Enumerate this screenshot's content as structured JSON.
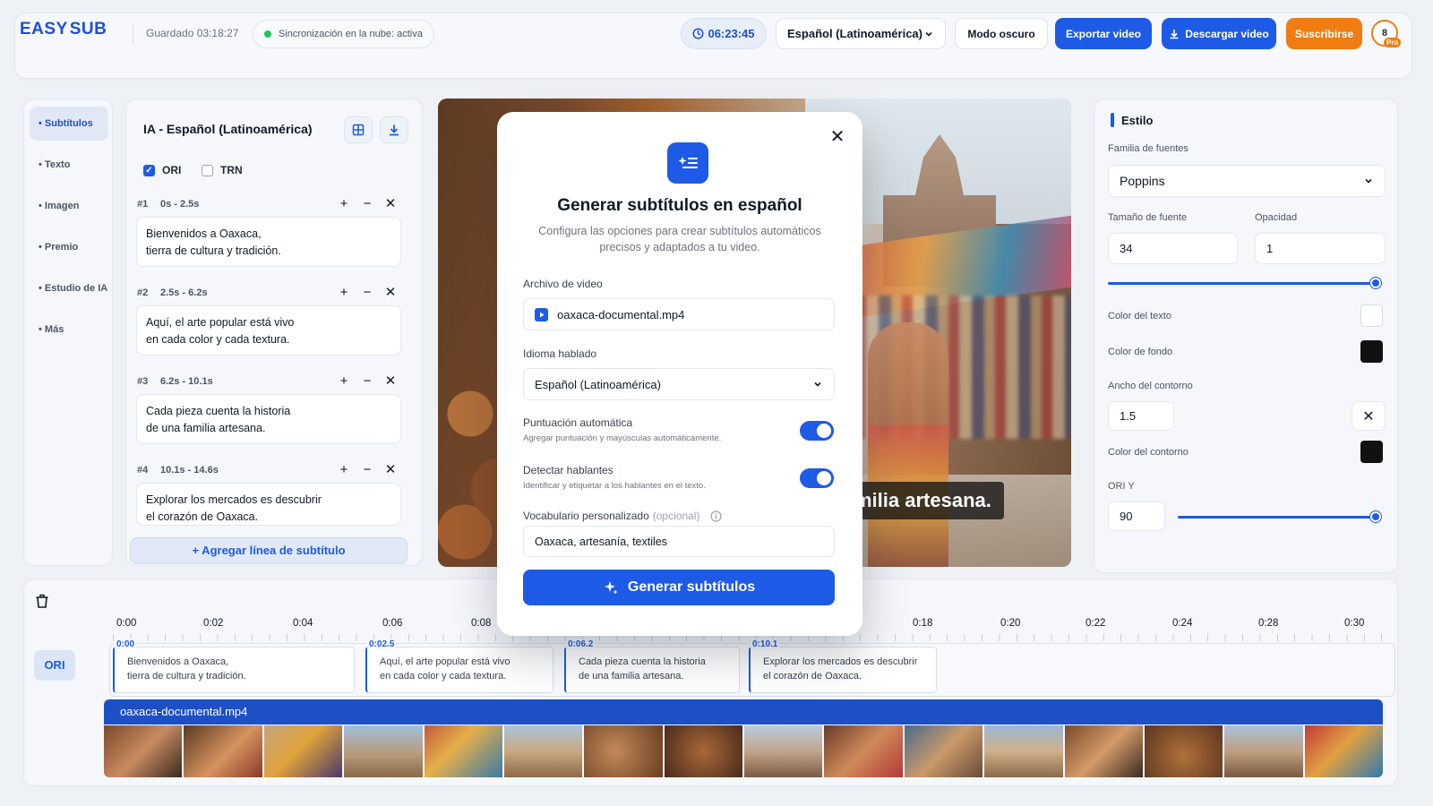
{
  "header": {
    "logo": "EASY",
    "logo_b": "SUB",
    "saved": "Guardado 03:18:27",
    "sync": "Sincronización en la nube: activa",
    "timer": "06:23:45",
    "language": "Español (Latinoamérica)",
    "dark_mode": "Modo oscuro",
    "export": "Exportar video",
    "download": "Descargar video",
    "subscribe": "Suscribirse",
    "avatar": "8",
    "badge": "Pro"
  },
  "nav": {
    "items": [
      "Subtítulos",
      "Texto",
      "Imagen",
      "Premio",
      "Estudio de IA",
      "Más"
    ]
  },
  "subtitles": {
    "title": "IA - Español (Latinoamérica)",
    "ori": "ORI",
    "trn": "TRN",
    "add_line": "+ Agregar línea de subtítulo",
    "items": [
      {
        "num": "#1",
        "time": "0s - 2.5s",
        "text": "Bienvenidos a Oaxaca,\ntierra de cultura y tradición."
      },
      {
        "num": "#2",
        "time": "2.5s - 6.2s",
        "text": "Aquí, el arte popular está vivo\nen cada color y cada textura."
      },
      {
        "num": "#3",
        "time": "6.2s - 10.1s",
        "text": "Cada pieza cuenta la historia\nde una familia artesana."
      },
      {
        "num": "#4",
        "time": "10.1s - 14.6s",
        "text": "Explorar los mercados es descubrir\nel corazón de Oaxaca."
      }
    ]
  },
  "preview": {
    "caption": "milia artesana."
  },
  "modal": {
    "title": "Generar subtítulos en español",
    "subtitle": "Configura las opciones para crear subtítulos automáticos precisos y adaptados a tu video.",
    "file_label": "Archivo de video",
    "file_value": "oaxaca-documental.mp4",
    "lang_label": "Idioma hablado",
    "lang_value": "Español (Latinoamérica)",
    "punct_label": "Puntuación automática",
    "punct_hint": "Agregar puntuación y mayúsculas automáticamente.",
    "speakers_label": "Detectar hablantes",
    "speakers_hint": "Identificar y etiquetar a los hablantes en el texto.",
    "vocab_label": "Vocabulario personalizado",
    "vocab_optional": "(opcional)",
    "vocab_value": "Oaxaca, artesanía, textiles",
    "cta": "Generar subtítulos"
  },
  "style": {
    "title": "Estilo",
    "font_family_label": "Familia de fuentes",
    "font_family": "Poppins",
    "font_size_label": "Tamaño de fuente",
    "font_size": "34",
    "opacity_label": "Opacidad",
    "opacity": "1",
    "text_color_label": "Color del texto",
    "text_color": "#ffffff",
    "bg_color_label": "Color de fondo",
    "bg_color": "#111111",
    "outline_width_label": "Ancho del contorno",
    "outline_width": "1.5",
    "outline_color_label": "Color del contorno",
    "outline_color": "#111111",
    "ori_y_label": "ORI Y",
    "ori_y": "90"
  },
  "timeline": {
    "ticks": [
      "0:00",
      "0:02",
      "0:04",
      "0:06",
      "0:08",
      "0:18",
      "0:20",
      "0:22",
      "0:24",
      "0:28",
      "0:30"
    ],
    "track_label": "ORI",
    "clips": [
      {
        "time": "0:00",
        "text": "Bienvenidos a Oaxaca,\ntierra de cultura y tradición."
      },
      {
        "time": "0:02.5",
        "text": "Aquí, el arte popular está vivo\nen cada color y cada textura."
      },
      {
        "time": "0:06.2",
        "text": "Cada pieza cuenta la historia\nde una familia artesana."
      },
      {
        "time": "0:10.1",
        "text": "Explorar los mercados es descubrir\nel corazón de Oaxaca."
      }
    ],
    "video_file": "oaxaca-documental.mp4"
  },
  "colors": {
    "accent": "#1d5be6",
    "orange": "#f07d11"
  }
}
